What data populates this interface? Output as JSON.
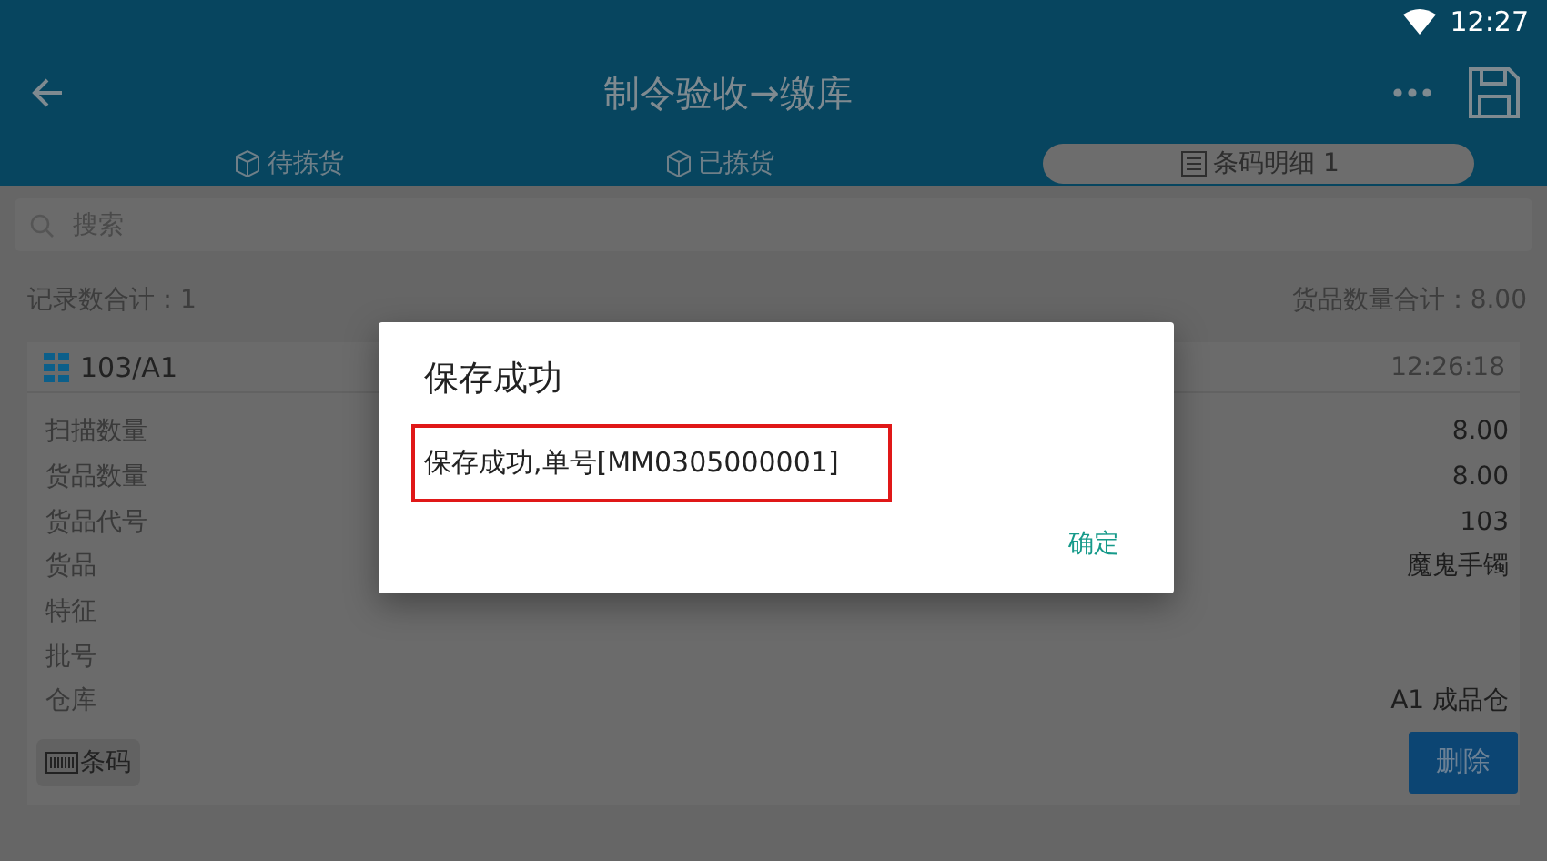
{
  "status_bar": {
    "time": "12:27"
  },
  "header": {
    "title": "制令验收→缴库"
  },
  "tabs": [
    {
      "label": "待拣货",
      "kind": "pending",
      "selected": false
    },
    {
      "label": "已拣货",
      "kind": "picked",
      "selected": false
    },
    {
      "label": "条码明细 1",
      "kind": "list",
      "selected": true
    }
  ],
  "search": {
    "placeholder": "搜索"
  },
  "summary": {
    "record_count": "记录数合计：1",
    "quantity_total": "货品数量合计：8.00"
  },
  "card": {
    "code": "103/A1",
    "time": "12:26:18",
    "fields": [
      {
        "label": "扫描数量",
        "value": "8.00"
      },
      {
        "label": "货品数量",
        "value": "8.00"
      },
      {
        "label": "货品代号",
        "value": "103"
      },
      {
        "label": "货品",
        "value": "魔鬼手镯"
      },
      {
        "label": "特征"
      },
      {
        "label": "批号"
      },
      {
        "label": "仓库",
        "value": "A1 成品仓"
      }
    ],
    "barcode_button": "条码",
    "delete_button": "删除"
  },
  "dialog": {
    "title": "保存成功",
    "message": "保存成功,单号[MM0305000001]",
    "confirm": "确定"
  }
}
